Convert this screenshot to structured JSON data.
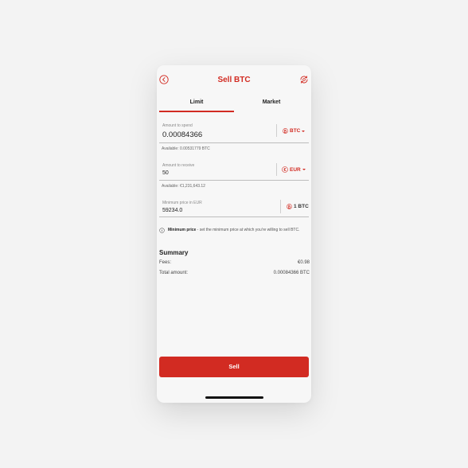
{
  "header": {
    "title": "Sell BTC"
  },
  "tabs": {
    "limit": "Limit",
    "market": "Market"
  },
  "spend": {
    "label": "Amount to spend",
    "value": "0.00084366",
    "currency": "BTC",
    "available": "Available: 0.00531779 BTC"
  },
  "receive": {
    "label": "Amount to receive",
    "value": "50",
    "currency": "EUR",
    "available": "Available: €1,231,643.12"
  },
  "min_price": {
    "label": "Minimum price in EUR",
    "value": "59234.0",
    "unit": "1 BTC"
  },
  "info": {
    "bold": "Minimum price",
    "text": " - set the minimum price at which you're willing to sell BTC."
  },
  "summary": {
    "title": "Summary",
    "fees_label": "Fees:",
    "fees_value": "€0.98",
    "total_label": "Total amount:",
    "total_value": "0.00084366 BTC"
  },
  "sell_button": "Sell",
  "colors": {
    "accent": "#d22b22",
    "background": "#f7f7f7"
  }
}
